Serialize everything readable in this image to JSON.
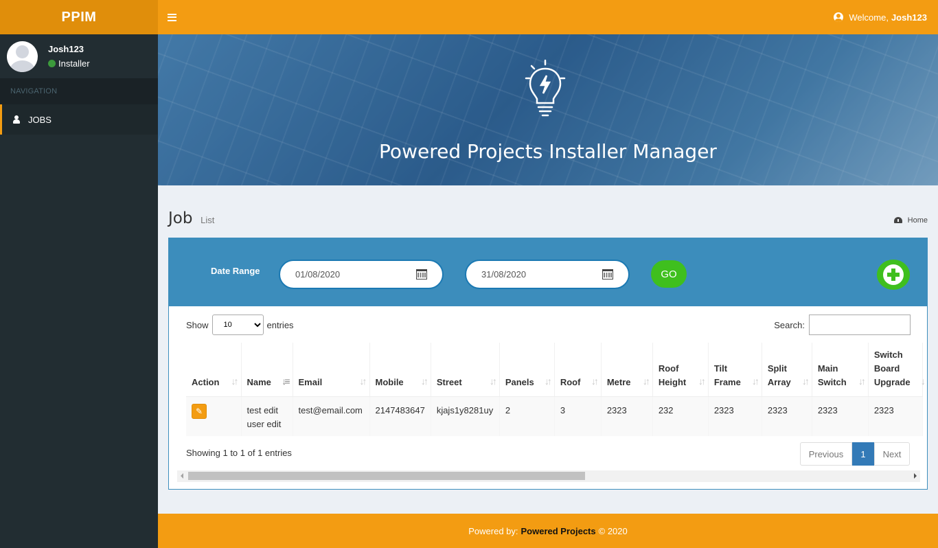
{
  "brand": "PPIM",
  "user": {
    "name": "Josh123",
    "role": "Installer"
  },
  "nav": {
    "header": "NAVIGATION",
    "items": [
      {
        "label": "JOBS"
      }
    ]
  },
  "topbar": {
    "welcome_prefix": "Welcome,",
    "welcome_user": "Josh123"
  },
  "banner": {
    "title": "Powered Projects Installer Manager"
  },
  "page": {
    "title": "Job",
    "subtitle": "List",
    "breadcrumb": "Home"
  },
  "filters": {
    "date_range_label": "Date Range",
    "from_date": "01/08/2020",
    "to_date": "31/08/2020",
    "go_label": "GO"
  },
  "table_controls": {
    "show_label": "Show",
    "entries_label": "entries",
    "page_length": "10",
    "search_label": "Search:",
    "search_value": ""
  },
  "table": {
    "columns": [
      "Action",
      "Name",
      "Email",
      "Mobile",
      "Street",
      "Panels",
      "Roof",
      "Metre",
      "Roof Height",
      "Tilt Frame",
      "Split Array",
      "Main Switch",
      "Switch Board Upgrade"
    ],
    "rows": [
      {
        "name": "test edit user edit",
        "email": "test@email.com",
        "mobile": "2147483647",
        "street": "kjajs1y8281uy",
        "panels": "2",
        "roof": "3",
        "metre": "2323",
        "roof_height": "232",
        "tilt_frame": "2323",
        "split_array": "2323",
        "main_switch": "2323",
        "switch_board_upgrade": "2323"
      }
    ]
  },
  "pagination": {
    "info": "Showing 1 to 1 of 1 entries",
    "previous": "Previous",
    "current": "1",
    "next": "Next"
  },
  "footer": {
    "prefix": "Powered by:",
    "company": "Powered Projects",
    "suffix": "© 2020"
  },
  "colors": {
    "accent": "#f39c12",
    "accent_dark": "#e08e0b",
    "sidebar": "#222d32",
    "box": "#3c8dbc",
    "go": "#3fbf1e",
    "page_active": "#337ab7"
  }
}
